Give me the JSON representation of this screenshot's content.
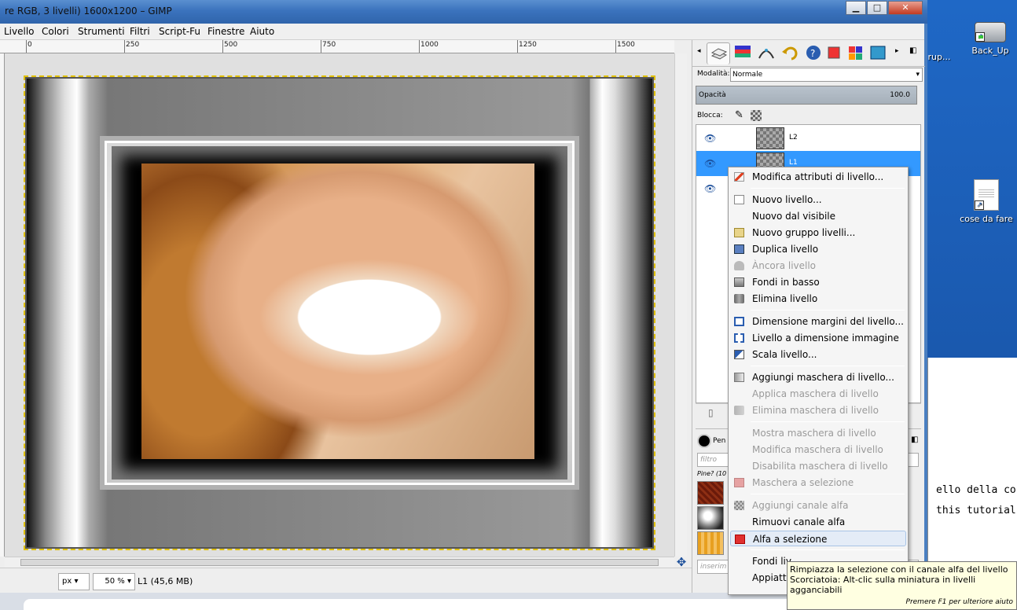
{
  "window": {
    "title": "re RGB, 3 livelli) 1600x1200 – GIMP",
    "buttons": {
      "minimize": "▁",
      "maximize": "□",
      "close": "✕"
    }
  },
  "menubar": [
    "Livello",
    "Colori",
    "Strumenti",
    "Filtri",
    "Script-Fu",
    "Finestre",
    "Aiuto"
  ],
  "ruler": {
    "labels": [
      "0",
      "250",
      "500",
      "750",
      "1000",
      "1250",
      "1500"
    ]
  },
  "statusbar": {
    "unit": "px",
    "zoom": "50 %",
    "info": "L1 (45,6 MB)"
  },
  "layers_panel": {
    "mode_label": "Modalità:",
    "mode_value": "Normale",
    "opacity_label": "Opacità",
    "opacity_value": "100.0",
    "lock_label": "Blocca:",
    "layers": [
      {
        "name": "L2",
        "selected": false
      },
      {
        "name": "L1",
        "selected": true
      },
      {
        "name": "",
        "selected": false
      }
    ]
  },
  "brushes_panel": {
    "tab_label": "Pen",
    "filter_placeholder": "filtro",
    "brush_label": "Pine? (10",
    "tag_placeholder": "inserim"
  },
  "context_menu": {
    "items": [
      {
        "label": "Modifica attributi di livello...",
        "enabled": true,
        "icon": "edit-icon"
      },
      {
        "sep": true
      },
      {
        "label": "Nuovo livello...",
        "enabled": true,
        "icon": "new-page-icon"
      },
      {
        "label": "Nuovo dal visibile",
        "enabled": true,
        "icon": ""
      },
      {
        "label": "Nuovo gruppo livelli...",
        "enabled": true,
        "icon": "folder-icon"
      },
      {
        "label": "Duplica livello",
        "enabled": true,
        "icon": "duplicate-icon"
      },
      {
        "label": "Àncora livello",
        "enabled": false,
        "icon": "anchor-icon"
      },
      {
        "label": "Fondi in basso",
        "enabled": true,
        "icon": "merge-down-icon"
      },
      {
        "label": "Elimina livello",
        "enabled": true,
        "icon": "trash-icon"
      },
      {
        "sep": true
      },
      {
        "label": "Dimensione margini del livello...",
        "enabled": true,
        "icon": "boundary-icon"
      },
      {
        "label": "Livello a dimensione immagine",
        "enabled": true,
        "icon": "fit-image-icon"
      },
      {
        "label": "Scala livello...",
        "enabled": true,
        "icon": "scale-icon"
      },
      {
        "sep": true
      },
      {
        "label": "Aggiungi maschera di livello...",
        "enabled": true,
        "icon": "add-mask-icon"
      },
      {
        "label": "Applica maschera di livello",
        "enabled": false,
        "icon": ""
      },
      {
        "label": "Elimina maschera di livello",
        "enabled": false,
        "icon": "delete-mask-icon"
      },
      {
        "sep": true
      },
      {
        "label": "Mostra maschera di livello",
        "enabled": false,
        "icon": ""
      },
      {
        "label": "Modifica maschera di livello",
        "enabled": false,
        "icon": ""
      },
      {
        "label": "Disabilita maschera di livello",
        "enabled": false,
        "icon": ""
      },
      {
        "label": "Maschera a selezione",
        "enabled": false,
        "icon": "mask-selection-icon"
      },
      {
        "sep": true
      },
      {
        "label": "Aggiungi canale alfa",
        "enabled": false,
        "icon": "alpha-icon"
      },
      {
        "label": "Rimuovi canale alfa",
        "enabled": true,
        "icon": ""
      },
      {
        "label": "Alfa a selezione",
        "enabled": true,
        "icon": "alpha-selection-icon",
        "highlighted": true
      },
      {
        "sep": true
      },
      {
        "label": "Fondi liv",
        "enabled": true,
        "icon": ""
      },
      {
        "label": "Appiattis",
        "enabled": true,
        "icon": ""
      }
    ]
  },
  "tooltip": {
    "line1": "Rimpiazza la selezione con il canale alfa del livello",
    "line2": "Scorciatoia: Alt-clic sulla miniatura in livelli agganciabili",
    "hint": "Premere F1 per ulteriore aiuto"
  },
  "desktop": {
    "icons": [
      {
        "label": "rup..."
      },
      {
        "label": "Back_Up"
      },
      {
        "label": "cose da fare"
      }
    ],
    "doc_lines": [
      "ello della cor",
      "this tutorial"
    ]
  },
  "colors": {
    "titlebar": "#3b73bd",
    "selection": "#3399ff",
    "tooltip_bg": "#ffffe1"
  }
}
